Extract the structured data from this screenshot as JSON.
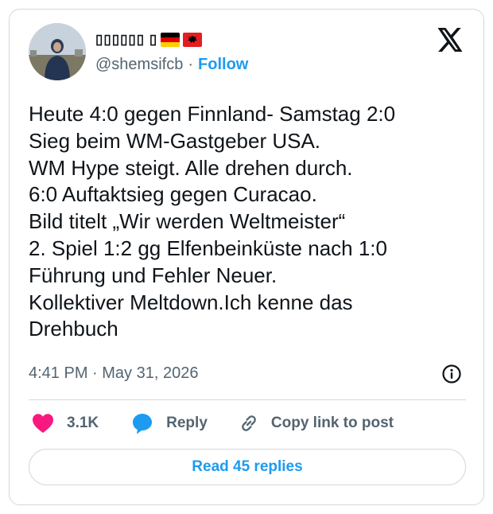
{
  "author": {
    "display_name": "▯▯▯▯▯▯ ▯",
    "handle": "@shemsifcb",
    "separator": "·",
    "follow_label": "Follow",
    "flags": [
      "germany-flag",
      "albania-flag"
    ]
  },
  "tweet": {
    "lines": [
      "Heute 4:0 gegen Finnland- Samstag 2:0",
      "Sieg beim WM-Gastgeber USA.",
      "WM Hype steigt. Alle drehen durch.",
      "6:0 Auftaktsieg gegen Curacao.",
      "Bild titelt „Wir werden Weltmeister“",
      "2. Spiel 1:2 gg Elfenbeinküste nach 1:0",
      "Führung und Fehler Neuer.",
      "Kollektiver Meltdown.Ich kenne das",
      "Drehbuch"
    ],
    "timestamp": "4:41 PM · May 31, 2026"
  },
  "actions": {
    "likes": "3.1K",
    "reply_label": "Reply",
    "copy_link_label": "Copy link to post"
  },
  "footer": {
    "read_replies_label": "Read 45 replies"
  },
  "colors": {
    "accent": "#1d9bf0",
    "like": "#f91880",
    "muted": "#536471",
    "border": "#cfd9de"
  },
  "icons": [
    "x-logo-icon",
    "info-icon",
    "heart-icon",
    "reply-bubble-icon",
    "link-icon"
  ]
}
